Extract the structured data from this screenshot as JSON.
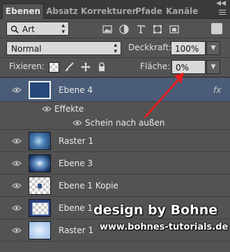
{
  "tabs": [
    {
      "label": "Ebenen",
      "active": true
    },
    {
      "label": "Absatz",
      "active": false
    },
    {
      "label": "Korrekturen",
      "active": false
    },
    {
      "label": "Pfade",
      "active": false
    },
    {
      "label": "Kanäle",
      "active": false
    }
  ],
  "filter": {
    "kind_label": "Art"
  },
  "blend": {
    "mode": "Normal",
    "opacity_label": "Deckkraft:",
    "opacity_value": "100%"
  },
  "lock": {
    "label": "Fixieren:",
    "fill_label": "Fläche:",
    "fill_value": "0%"
  },
  "layers": [
    {
      "name": "Ebene 4",
      "selected": true,
      "fx": "fx"
    },
    {
      "name": "Raster 1",
      "selected": false
    },
    {
      "name": "Ebene 3",
      "selected": false
    },
    {
      "name": "Ebene 1 Kopie",
      "selected": false
    },
    {
      "name": "Ebene 1",
      "selected": false
    },
    {
      "name": "Raster 1",
      "selected": false
    }
  ],
  "effects": {
    "header": "Effekte",
    "items": [
      "Schein nach außen"
    ]
  },
  "watermark": {
    "line1": "design by Bohne",
    "line2": "www.bohnes-tutorials.de"
  },
  "colors": {
    "accent_arrow": "#e02020",
    "selected_row": "#4a5c78",
    "panel": "#535353"
  }
}
